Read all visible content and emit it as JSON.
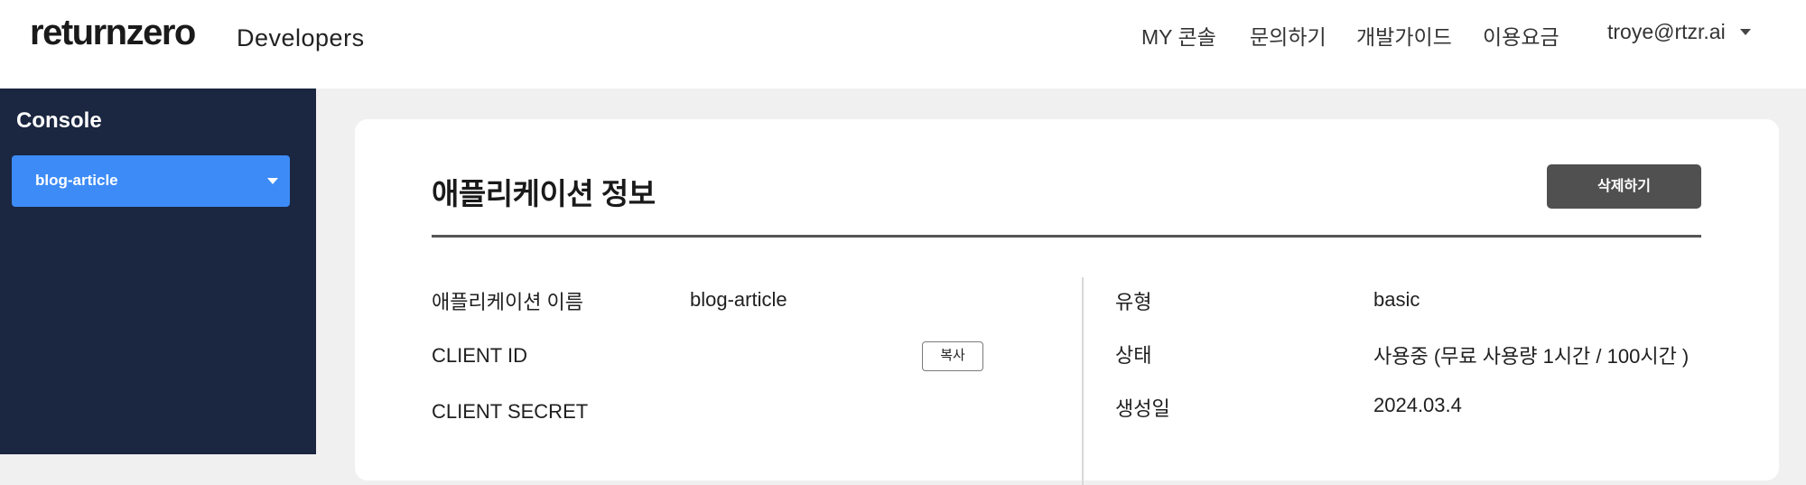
{
  "header": {
    "logo": "returnzero",
    "logo_sub": "Developers",
    "nav": [
      "MY 콘솔",
      "문의하기",
      "개발가이드",
      "이용요금"
    ],
    "user_email": "troye@rtzr.ai"
  },
  "sidebar": {
    "title": "Console",
    "selected_app": "blog-article"
  },
  "card": {
    "title": "애플리케이션 정보",
    "delete_label": "삭제하기",
    "copy_label": "복사",
    "left": [
      {
        "label": "애플리케이션 이름",
        "value": "blog-article"
      },
      {
        "label": "CLIENT ID",
        "value": ""
      },
      {
        "label": "CLIENT SECRET",
        "value": ""
      }
    ],
    "right": [
      {
        "label": "유형",
        "value": "basic"
      },
      {
        "label": "상태",
        "value": "사용중 (무료 사용량 1시간 / 100시간 )"
      },
      {
        "label": "생성일",
        "value": "2024.03.4"
      }
    ]
  },
  "colors": {
    "sidebar_bg": "#1b2640",
    "accent": "#3d8bf7",
    "delete_button": "#505050"
  }
}
